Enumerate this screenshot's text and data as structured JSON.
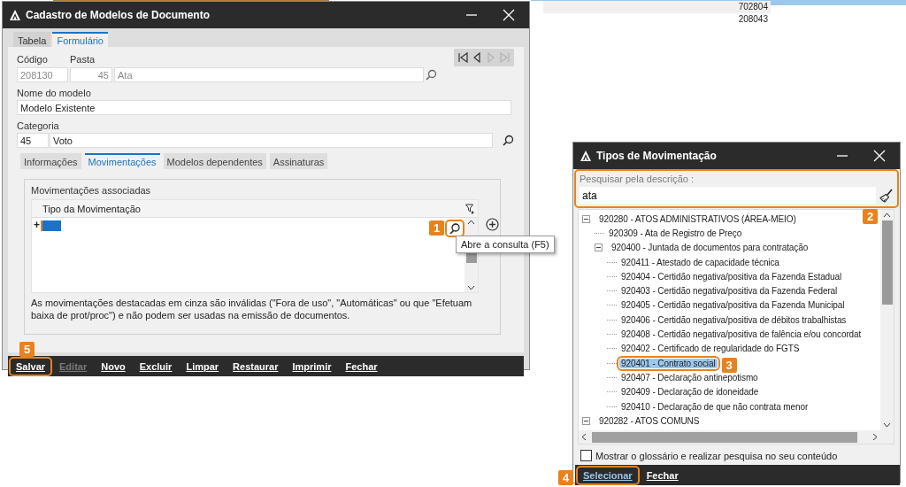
{
  "background_table": {
    "rows": [
      {
        "cell": "702804",
        "selected": false
      },
      {
        "cell": "208043",
        "selected": false
      }
    ]
  },
  "cadastro_window": {
    "title": "Cadastro de Modelos de Documento",
    "tabs": [
      {
        "label": "Tabela",
        "selected": false
      },
      {
        "label": "Formulário",
        "selected": true
      }
    ],
    "codigo": {
      "label": "Código",
      "value": "208130",
      "disabled": true
    },
    "pasta": {
      "label": "Pasta",
      "code": "45",
      "description": "Ata",
      "disabled": true
    },
    "record_nav": [
      {
        "kind": "first",
        "disabled": false
      },
      {
        "kind": "previous",
        "disabled": false
      },
      {
        "kind": "next",
        "disabled": true
      },
      {
        "kind": "last",
        "disabled": true
      }
    ],
    "nome_do_modelo": {
      "label": "Nome do modelo",
      "value": "Modelo Existente"
    },
    "categoria": {
      "label": "Categoria",
      "code": "45",
      "description": "Voto"
    },
    "subtabs": [
      {
        "label": "Informações",
        "selected": false
      },
      {
        "label": "Movimentações",
        "selected": true
      },
      {
        "label": "Modelos dependentes",
        "selected": false
      },
      {
        "label": "Assinaturas",
        "selected": false
      }
    ],
    "movimentacoes": {
      "title": "Movimentações associadas",
      "column": "Tipo da Movimentação",
      "rows": [
        {
          "marker": "+",
          "selected": true
        }
      ],
      "search_callout": "1",
      "tooltip": "Abre a consulta (F5)"
    },
    "note": "As movimentações destacadas em cinza são inválidas (\"Fora de uso\", \"Automáticas\" ou que \"Efetuam baixa de prot/proc\") e não podem ser usadas na emissão de documentos.",
    "toolbar": [
      {
        "label": "Salvar",
        "disabled": false,
        "callout": "5"
      },
      {
        "label": "Editar",
        "disabled": true
      },
      {
        "label": "Novo",
        "disabled": false
      },
      {
        "label": "Excluir",
        "disabled": false
      },
      {
        "label": "Limpar",
        "disabled": false
      },
      {
        "label": "Restaurar",
        "disabled": false
      },
      {
        "label": "Imprimir",
        "disabled": false
      },
      {
        "label": "Fechar",
        "disabled": false
      }
    ]
  },
  "tipos_window": {
    "title": "Tipos de Movimentação",
    "search": {
      "label": "Pesquisar pela descrição :",
      "value": "ata",
      "callout": "2"
    },
    "tree": [
      {
        "label": "920280 - ATOS ADMINISTRATIVOS (ÁREA-MEIO)",
        "expanded": true,
        "selected": false,
        "children": [
          {
            "label": "920309 - Ata de Registro de Preço",
            "selected": false
          },
          {
            "label": "920400 - Juntada de documentos para contratação",
            "expanded": true,
            "selected": false,
            "children": [
              {
                "label": "920411 - Atestado de capacidade técnica",
                "selected": false
              },
              {
                "label": "920404 - Certidão negativa/positiva da Fazenda Estadual",
                "selected": false
              },
              {
                "label": "920403 - Certidão negativa/positiva da Fazenda Federal",
                "selected": false
              },
              {
                "label": "920405 - Certidão negativa/positiva da Fazenda Municipal",
                "selected": false
              },
              {
                "label": "920406 - Certidão negativa/positiva de débitos trabalhistas",
                "selected": false
              },
              {
                "label": "920408 - Certidão negativa/positiva de falência e/ou concordat",
                "selected": false
              },
              {
                "label": "920402 - Certificado de regularidade do FGTS",
                "selected": false
              },
              {
                "label": "920401 - Contrato social",
                "selected": true,
                "callout": "3"
              },
              {
                "label": "920407 - Declaração antinepotismo",
                "selected": false
              },
              {
                "label": "920409 - Declaração de idoneidade",
                "selected": false
              },
              {
                "label": "920410 - Declaração de que não contrata menor",
                "selected": false
              }
            ]
          }
        ]
      },
      {
        "label": "920282 - ATOS COMUNS",
        "expanded": true,
        "selected": false
      }
    ],
    "glossary": {
      "label": "Mostrar o glossário e realizar pesquisa no seu conteúdo",
      "checked": false
    },
    "toolbar": [
      {
        "label": "Selecionar",
        "focused": true,
        "callout": "4"
      },
      {
        "label": "Fechar",
        "focused": false
      }
    ]
  }
}
